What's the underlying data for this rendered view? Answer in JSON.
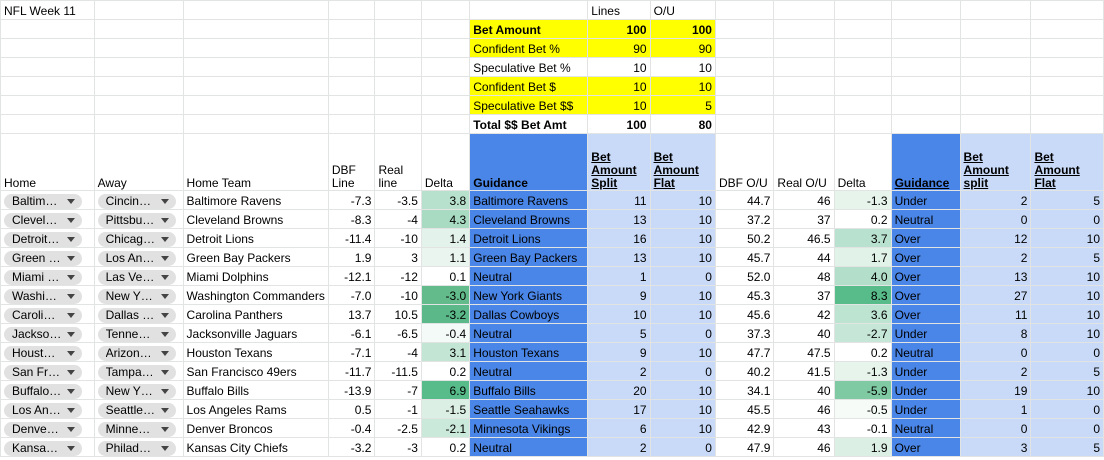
{
  "sheet": {
    "title": "NFL Week 11"
  },
  "colors": {
    "yellow": "#ffff00",
    "blue": "#4a86e8",
    "light_blue": "#c9daf8",
    "chip": "#e1e1e1"
  },
  "summary": {
    "col_lines": "Lines",
    "col_ou": "O/U",
    "rows": [
      {
        "label": "Bet Amount",
        "lines": "100",
        "ou": "100",
        "style": "yellow bold"
      },
      {
        "label": "Confident Bet %",
        "lines": "90",
        "ou": "90",
        "style": "yellow"
      },
      {
        "label": "Speculative Bet %",
        "lines": "10",
        "ou": "10",
        "style": ""
      },
      {
        "label": "Confident Bet $",
        "lines": "10",
        "ou": "10",
        "style": "yellow"
      },
      {
        "label": "Speculative Bet $$",
        "lines": "10",
        "ou": "5",
        "style": "yellow"
      },
      {
        "label": "Total $$ Bet Amt",
        "lines": "100",
        "ou": "80",
        "style": "bold"
      }
    ]
  },
  "headers": [
    "Home",
    "Away",
    "Home Team",
    "DBF Line",
    "Real line",
    "Delta",
    "Guidance",
    "Bet Amount Split",
    "Bet Amount Flat",
    "DBF O/U",
    "Real O/U",
    "Delta",
    "Guidance",
    "Bet Amount split",
    "Bet Amount Flat"
  ],
  "rows": [
    {
      "home": "Baltim…",
      "away": "Cincin…",
      "team": "Baltimore Ravens",
      "dbf": "-7.3",
      "real": "-3.5",
      "delta": "3.8",
      "dbg": "#b7e1cd",
      "guide": "Baltimore Ravens",
      "split": "11",
      "flat": "10",
      "dbfou": "44.7",
      "realou": "46",
      "delta2": "-1.3",
      "dbg2": "#e6f4ec",
      "guide2": "Under",
      "split2": "2",
      "flat2": "5"
    },
    {
      "home": "Clevel…",
      "away": "Pittsbu…",
      "team": "Cleveland Browns",
      "dbf": "-8.3",
      "real": "-4",
      "delta": "4.3",
      "dbg": "#a8dbc2",
      "guide": "Cleveland Browns",
      "split": "13",
      "flat": "10",
      "dbfou": "37.2",
      "realou": "37",
      "delta2": "0.2",
      "dbg2": "#ffffff",
      "guide2": "Neutral",
      "split2": "0",
      "flat2": "0"
    },
    {
      "home": "Detroit…",
      "away": "Chicag…",
      "team": "Detroit Lions",
      "dbf": "-11.4",
      "real": "-10",
      "delta": "1.4",
      "dbg": "#e3f2ea",
      "guide": "Detroit Lions",
      "split": "16",
      "flat": "10",
      "dbfou": "50.2",
      "realou": "46.5",
      "delta2": "3.7",
      "dbg2": "#b9e1cf",
      "guide2": "Over",
      "split2": "12",
      "flat2": "10"
    },
    {
      "home": "Green …",
      "away": "Los An…",
      "team": "Green Bay Packers",
      "dbf": "1.9",
      "real": "3",
      "delta": "1.1",
      "dbg": "#e9f5ee",
      "guide": "Green Bay Packers",
      "split": "13",
      "flat": "10",
      "dbfou": "45.7",
      "realou": "44",
      "delta2": "1.7",
      "dbg2": "#e1f2e8",
      "guide2": "Over",
      "split2": "2",
      "flat2": "5"
    },
    {
      "home": "Miami …",
      "away": "Las Ve…",
      "team": "Miami Dolphins",
      "dbf": "-12.1",
      "real": "-12",
      "delta": "0.1",
      "dbg": "#ffffff",
      "guide": "Neutral",
      "split": "1",
      "flat": "0",
      "dbfou": "52.0",
      "realou": "48",
      "delta2": "4.0",
      "dbg2": "#b3dfca",
      "guide2": "Over",
      "split2": "13",
      "flat2": "10"
    },
    {
      "home": "Washi…",
      "away": "New Y…",
      "team": "Washington Commanders",
      "dbf": "-7.0",
      "real": "-10",
      "delta": "-3.0",
      "dbg": "#63bb8b",
      "guide": "New York Giants",
      "split": "9",
      "flat": "10",
      "dbfou": "45.3",
      "realou": "37",
      "delta2": "8.3",
      "dbg2": "#57bb8a",
      "guide2": "Over",
      "split2": "27",
      "flat2": "10"
    },
    {
      "home": "Caroli…",
      "away": "Dallas …",
      "team": "Carolina Panthers",
      "dbf": "13.7",
      "real": "10.5",
      "delta": "-3.2",
      "dbg": "#5ab889",
      "guide": "Dallas Cowboys",
      "split": "10",
      "flat": "10",
      "dbfou": "45.6",
      "realou": "42",
      "delta2": "3.6",
      "dbg2": "#bde3d1",
      "guide2": "Over",
      "split2": "11",
      "flat2": "10"
    },
    {
      "home": "Jackso…",
      "away": "Tenne…",
      "team": "Jacksonville Jaguars",
      "dbf": "-6.1",
      "real": "-6.5",
      "delta": "-0.4",
      "dbg": "#f4faf7",
      "guide": "Neutral",
      "split": "5",
      "flat": "0",
      "dbfou": "37.3",
      "realou": "40",
      "delta2": "-2.7",
      "dbg2": "#c6e7d8",
      "guide2": "Under",
      "split2": "8",
      "flat2": "10"
    },
    {
      "home": "Houst…",
      "away": "Arizon…",
      "team": "Houston Texans",
      "dbf": "-7.1",
      "real": "-4",
      "delta": "3.1",
      "dbg": "#c2e5d4",
      "guide": "Houston Texans",
      "split": "9",
      "flat": "10",
      "dbfou": "47.7",
      "realou": "47.5",
      "delta2": "0.2",
      "dbg2": "#ffffff",
      "guide2": "Neutral",
      "split2": "0",
      "flat2": "0"
    },
    {
      "home": "San Fr…",
      "away": "Tampa…",
      "team": "San Francisco 49ers",
      "dbf": "-11.7",
      "real": "-11.5",
      "delta": "0.2",
      "dbg": "#ffffff",
      "guide": "Neutral",
      "split": "2",
      "flat": "0",
      "dbfou": "40.2",
      "realou": "41.5",
      "delta2": "-1.3",
      "dbg2": "#e6f4ec",
      "guide2": "Under",
      "split2": "2",
      "flat2": "5"
    },
    {
      "home": "Buffalo…",
      "away": "New Y…",
      "team": "Buffalo Bills",
      "dbf": "-13.9",
      "real": "-7",
      "delta": "6.9",
      "dbg": "#57bb8a",
      "guide": "Buffalo Bills",
      "split": "20",
      "flat": "10",
      "dbfou": "34.1",
      "realou": "40",
      "delta2": "-5.9",
      "dbg2": "#7fc9a3",
      "guide2": "Under",
      "split2": "19",
      "flat2": "10"
    },
    {
      "home": "Los An…",
      "away": "Seattle…",
      "team": "Los Angeles Rams",
      "dbf": "0.5",
      "real": "-1",
      "delta": "-1.5",
      "dbg": "#dcefe5",
      "guide": "Seattle Seahawks",
      "split": "17",
      "flat": "10",
      "dbfou": "45.5",
      "realou": "46",
      "delta2": "-0.5",
      "dbg2": "#f6fbf8",
      "guide2": "Under",
      "split2": "1",
      "flat2": "0"
    },
    {
      "home": "Denve…",
      "away": "Minne…",
      "team": "Denver Broncos",
      "dbf": "-0.4",
      "real": "-2.5",
      "delta": "-2.1",
      "dbg": "#cbe9db",
      "guide": "Minnesota Vikings",
      "split": "6",
      "flat": "10",
      "dbfou": "42.9",
      "realou": "43",
      "delta2": "-0.1",
      "dbg2": "#ffffff",
      "guide2": "Neutral",
      "split2": "0",
      "flat2": "0"
    },
    {
      "home": "Kansa…",
      "away": "Philad…",
      "team": "Kansas City Chiefs",
      "dbf": "-3.2",
      "real": "-3",
      "delta": "0.2",
      "dbg": "#ffffff",
      "guide": "Neutral",
      "split": "2",
      "flat": "0",
      "dbfou": "47.9",
      "realou": "46",
      "delta2": "1.9",
      "dbg2": "#dcefe5",
      "guide2": "Over",
      "split2": "3",
      "flat2": "5"
    }
  ]
}
